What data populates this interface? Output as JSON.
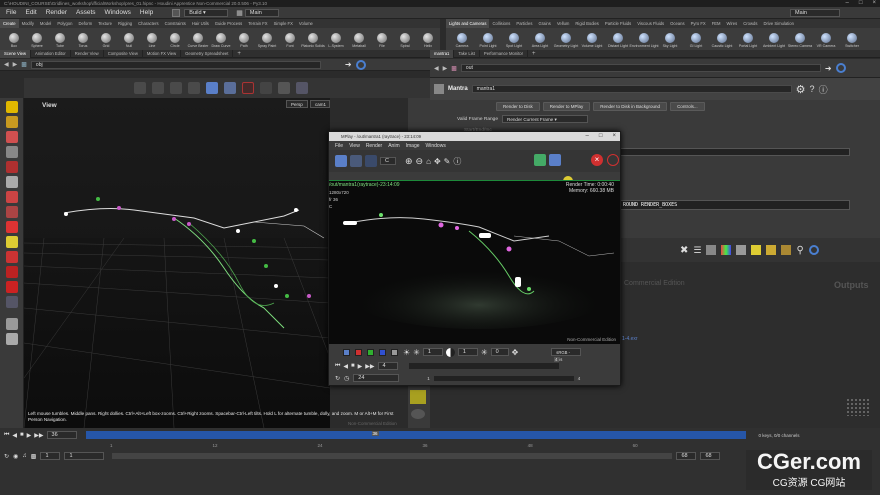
{
  "window": {
    "title": "C:\\HOUDINI_COURSE\\Gridlines_workshop\\ifficialWorkshop\\pres_01.hipnc - Houdini Apprentice Non-Commercial 20.0.506 - Py3.10"
  },
  "menubar": {
    "items": [
      "File",
      "Edit",
      "Render",
      "Assets",
      "Windows",
      "Help"
    ],
    "desktop": "Build",
    "scene": "Main",
    "right_scene": "Main"
  },
  "shelf_left": {
    "tabs": [
      "Create",
      "Modify",
      "Model",
      "Polygon",
      "Deform",
      "Texture",
      "Rigging",
      "Characters",
      "Constraints",
      "Hair Utils",
      "Guide Process",
      "Terrain FX",
      "Simple FX",
      "Volume"
    ],
    "tools": [
      "Box",
      "Sphere",
      "Tube",
      "Torus",
      "Grid",
      "Null",
      "Line",
      "Circle",
      "Curve Bezier",
      "Draw Curve",
      "Path",
      "Spray Paint",
      "Font",
      "Platonic Solids",
      "L-System",
      "Metaball",
      "File",
      "Spiral",
      "Helix"
    ]
  },
  "shelf_right": {
    "tabs": [
      "Lights and Cameras",
      "Collisions",
      "Particles",
      "Grains",
      "Vellum",
      "Rigid Bodies",
      "Particle Fluids",
      "Viscous Fluids",
      "Oceans",
      "Pyro FX",
      "FEM",
      "Wires",
      "Crowds",
      "Drive Simulation"
    ],
    "tools": [
      "Camera",
      "Point Light",
      "Spot Light",
      "Area Light",
      "Geometry Light",
      "Volume Light",
      "Distant Light",
      "Environment Light",
      "Sky Light",
      "GI Light",
      "Caustic Light",
      "Portal Light",
      "Ambient Light",
      "Stereo Camera",
      "VR Camera",
      "Switcher"
    ]
  },
  "left_pane": {
    "tabs": [
      "Scene View",
      "Animation Editor",
      "Render View",
      "Composite View",
      "Motion FX View",
      "Geometry Spreadsheet"
    ],
    "path": "obj",
    "view_label": "View",
    "persp": "Persp",
    "cam": "cam1",
    "status": "Left mouse tumbles. Middle pans. Right dollies. Ctrl+Alt+Left box-zooms. Ctrl+Right zooms. Spacebar-Ctrl-Left tilts. Hold L for alternate tumble, dolly, and zoom. M or Alt+M for First Person Navigation.",
    "edition": "Non-Commercial Edition"
  },
  "right_top": {
    "tabs": [
      "mantra1",
      "Take List",
      "Performance Monitor"
    ],
    "path": "out",
    "node_type": "Mantra",
    "node_name": "mantra1",
    "buttons": [
      "Render to Disk",
      "Render to MPlay",
      "Render to Disk in Background",
      "Controls..."
    ],
    "valid_frame_label": "Valid Frame Range",
    "valid_frame_value": "Render Current Frame",
    "start_end": "Start/End/Inc",
    "param_text": "ROUND RENDER_BOXES"
  },
  "right_bottom": {
    "edition": "Commercial Edition",
    "outputs": "Outputs"
  },
  "mplay": {
    "title": "MPlay - /out/mantra1 (raytrace) - 23:14:09",
    "menu": [
      "File",
      "View",
      "Render",
      "Anim",
      "Image",
      "Windows"
    ],
    "path_label": "/out/mantra1(raytrace)-23:14:09",
    "resolution": "1280x720",
    "frame_info": "fr 36",
    "channel": "C",
    "render_time_label": "Render Time:",
    "render_time": "0:00:40",
    "memory_label": "Memory:",
    "memory": "660.38 MB",
    "edition": "Non-Commercial Edition",
    "field1": "1",
    "field2": "1",
    "field3": "0",
    "colorspace": "sRGB - Dis",
    "frame_start": "1",
    "frame_current": "4",
    "frame_end": "4",
    "fps": "24",
    "exr": "1-4.exr"
  },
  "timeline": {
    "frame": "36",
    "start": "1",
    "start2": "1",
    "end": "68",
    "end2": "68",
    "keys": "0 keys, 0/0 channels",
    "ticks": [
      "1",
      "12",
      "24",
      "36",
      "48",
      "60"
    ]
  },
  "watermark": {
    "main": "CGer.com",
    "sub": "CG资源 CG网站"
  },
  "colors": {
    "accent": "#2f6fd0",
    "render_green": "#1d8a3a",
    "stop_red": "#d03030"
  }
}
